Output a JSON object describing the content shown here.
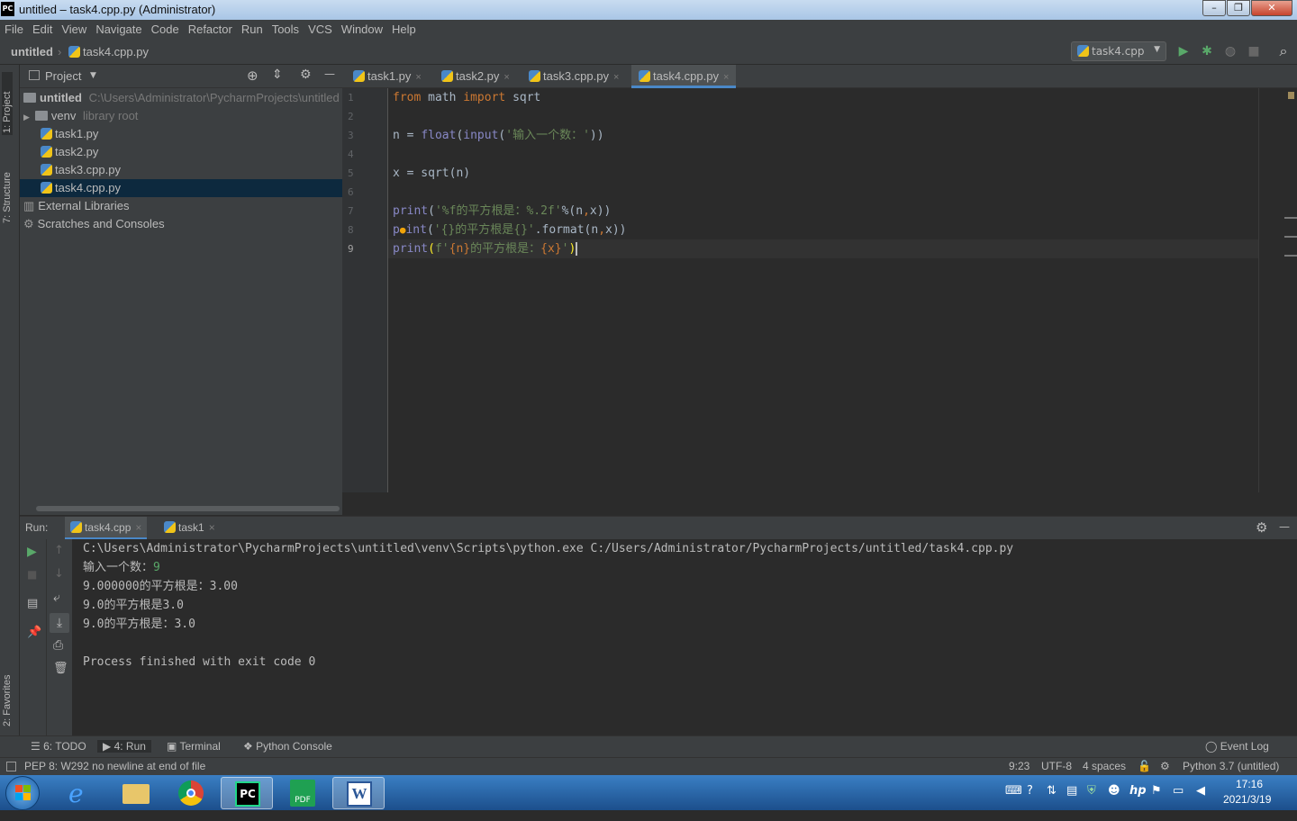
{
  "window": {
    "title": "untitled – task4.cpp.py (Administrator)",
    "app_icon": "PC",
    "minimize": "–",
    "maximize": "❐",
    "close": "✕"
  },
  "menu": [
    "File",
    "Edit",
    "View",
    "Navigate",
    "Code",
    "Refactor",
    "Run",
    "Tools",
    "VCS",
    "Window",
    "Help"
  ],
  "breadcrumb": {
    "project": "untitled",
    "file": "task4.cpp.py"
  },
  "run_config": {
    "name": "task4.cpp",
    "arrow": "▼"
  },
  "toolbar": {
    "run_icon": "▶",
    "debug_icon": "✱",
    "coverage_icon": "◍",
    "stop_icon": "■",
    "search_icon": "⌕"
  },
  "left_strip": {
    "project": "1: Project",
    "structure": "7: Structure",
    "favorites": "2: Favorites"
  },
  "project": {
    "header": "Project",
    "dropdown": "▼",
    "icons": {
      "locate": "⊕",
      "collapse": "⇕",
      "settings": "⚙",
      "hide": "—"
    },
    "tree": [
      {
        "label": "untitled",
        "hint": "C:\\Users\\Administrator\\PycharmProjects\\untitled",
        "type": "root"
      },
      {
        "label": "venv",
        "hint": "library root",
        "type": "folder"
      },
      {
        "label": "task1.py",
        "type": "file"
      },
      {
        "label": "task2.py",
        "type": "file"
      },
      {
        "label": "task3.cpp.py",
        "type": "file"
      },
      {
        "label": "task4.cpp.py",
        "type": "file",
        "selected": true
      },
      {
        "label": "External Libraries",
        "type": "lib"
      },
      {
        "label": "Scratches and Consoles",
        "type": "scratch"
      }
    ]
  },
  "tabs": [
    {
      "label": "task1.py",
      "close": "×"
    },
    {
      "label": "task2.py",
      "close": "×"
    },
    {
      "label": "task3.cpp.py",
      "close": "×"
    },
    {
      "label": "task4.cpp.py",
      "close": "×",
      "active": true
    }
  ],
  "line_numbers": [
    "1",
    "2",
    "3",
    "4",
    "5",
    "6",
    "7",
    "8",
    "9"
  ],
  "code": {
    "l1": {
      "k1": "from",
      "t1": " math ",
      "k2": "import",
      "t2": " sqrt"
    },
    "l3": {
      "t1": "n = ",
      "f1": "float",
      "t2": "(",
      "f2": "input",
      "t3": "(",
      "s1": "'输入一个数：'",
      "t4": "))"
    },
    "l5": {
      "t1": "x = sqrt(n)"
    },
    "l7": {
      "f1": "print",
      "t1": "(",
      "s1": "'%f的平方根是：%.2f'",
      "t2": "%(n",
      "t3": ",",
      "t4": "x))"
    },
    "l8": {
      "t0": "p",
      "bulb": "●",
      "t0b": "int",
      "t1": "(",
      "s1": "'{}的平方根是{}'",
      "t2": ".format(n",
      "t3": ",",
      "t4": "x))"
    },
    "l9": {
      "f1": "print",
      "t1": "(",
      "s1": "f'",
      "t2": "{n}",
      "s2": "的平方根是：",
      "t3": "{x}",
      "s3": "'",
      "t4": ")"
    }
  },
  "run": {
    "label": "Run:",
    "tabs": [
      {
        "label": "task4.cpp",
        "close": "×"
      },
      {
        "label": "task1",
        "close": "×"
      }
    ],
    "settings_icon": "⚙",
    "hide_icon": "—",
    "output": [
      "C:\\Users\\Administrator\\PycharmProjects\\untitled\\venv\\Scripts\\python.exe C:/Users/Administrator/PycharmProjects/untitled/task4.cpp.py",
      "输入一个数：",
      "9.000000的平方根是：3.00",
      "9.0的平方根是3.0",
      "9.0的平方根是：3.0",
      "",
      "Process finished with exit code 0"
    ],
    "input_value": "9",
    "side_icons": {
      "run": "▶",
      "stop": "■",
      "up": "↑",
      "down": "↓",
      "layout": "▤",
      "wrap": "⤶",
      "scroll": "⤓",
      "pin": "📌",
      "print": "⎙",
      "trash": "🗑"
    }
  },
  "bottom_tabs": [
    {
      "icon": "☰",
      "label": "6: TODO"
    },
    {
      "icon": "▶",
      "label": "4: Run"
    },
    {
      "icon": "▣",
      "label": "Terminal"
    },
    {
      "icon": "❖",
      "label": "Python Console"
    }
  ],
  "event_log": {
    "icon": "◯",
    "label": "Event Log"
  },
  "status": {
    "message": "PEP 8: W292 no newline at end of file",
    "position": "9:23",
    "encoding": "UTF-8",
    "indent": "4 spaces",
    "interpreter": "Python 3.7 (untitled)"
  },
  "taskbar": {
    "time": "17:16",
    "date": "2021/3/19",
    "apps": [
      "windows-start",
      "internet-explorer",
      "file-explorer",
      "chrome",
      "pycharm",
      "pdf",
      "word"
    ],
    "pycharm_label": "PC",
    "pdf_label": "PDF",
    "word_label": "W"
  },
  "colors": {
    "keyword": "#cc7832",
    "string": "#6a8759",
    "builtin": "#8888c6",
    "accent": "#4a88c7"
  }
}
